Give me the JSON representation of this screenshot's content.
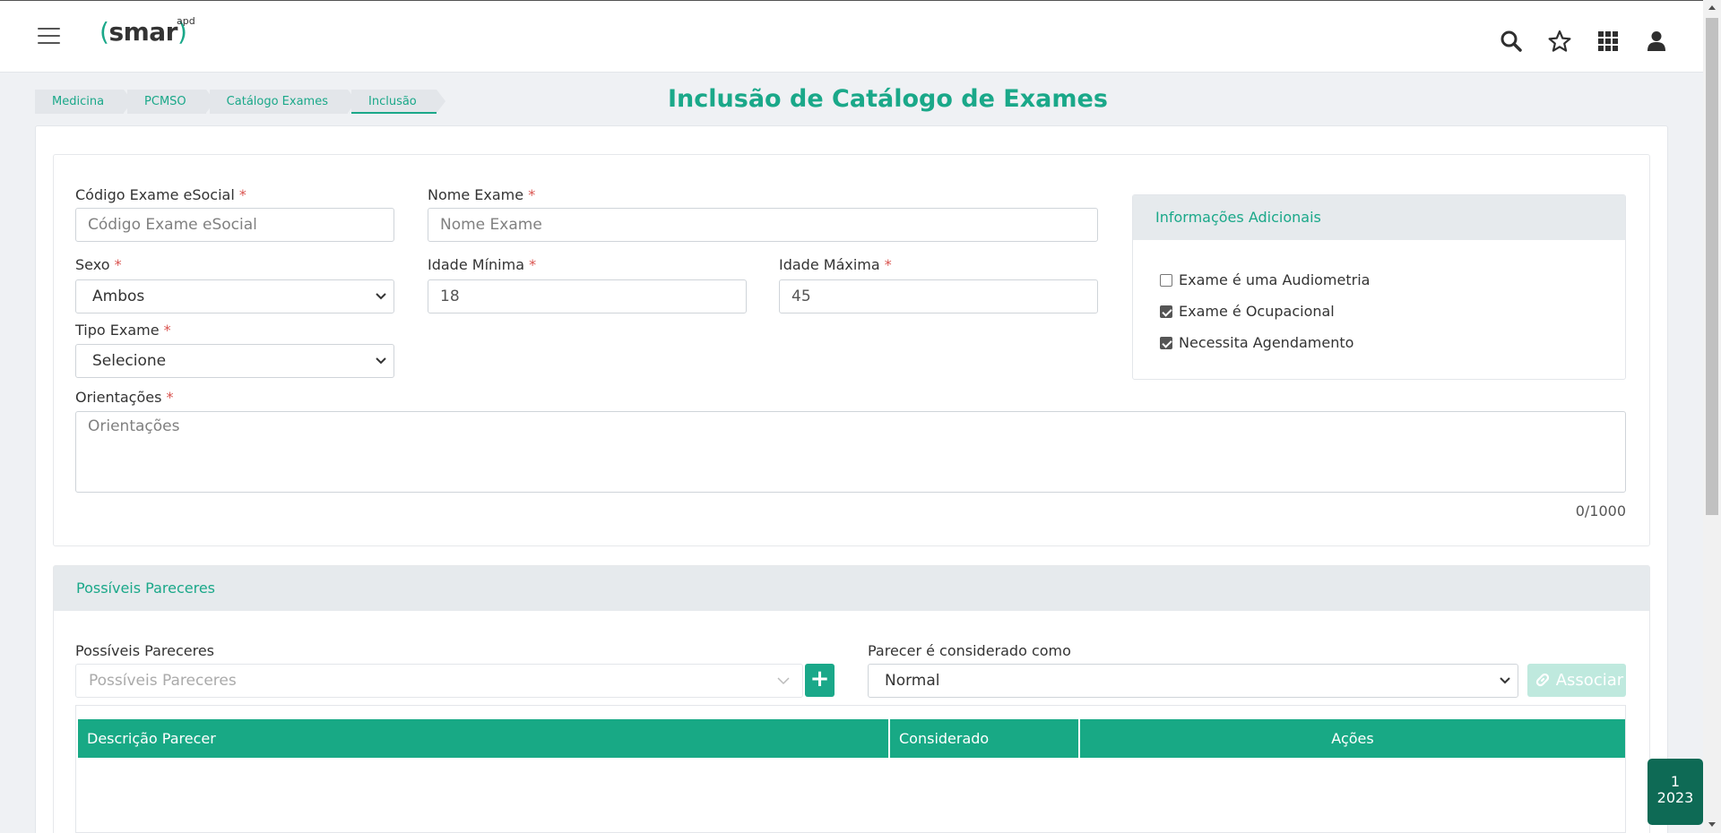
{
  "header": {
    "logo_text": "smar",
    "logo_suffix": "apd",
    "icons": [
      "search-icon",
      "star-icon",
      "apps-grid-icon",
      "user-icon",
      "menu-icon"
    ]
  },
  "breadcrumb": [
    "Medicina",
    "PCMSO",
    "Catálogo Exames",
    "Inclusão"
  ],
  "page_title": "Inclusão de Catálogo de Exames",
  "form": {
    "codigo_label": "Código Exame eSocial",
    "codigo_placeholder": "Código Exame eSocial",
    "nome_label": "Nome Exame",
    "nome_placeholder": "Nome Exame",
    "sexo_label": "Sexo",
    "sexo_value": "Ambos",
    "idade_min_label": "Idade Mínima",
    "idade_min_value": "18",
    "idade_max_label": "Idade Máxima",
    "idade_max_value": "45",
    "tipo_label": "Tipo Exame",
    "tipo_value": "Selecione",
    "orientacoes_label": "Orientações",
    "orientacoes_placeholder": "Orientações",
    "counter": "0/1000",
    "required_mark": "*"
  },
  "info_panel": {
    "title": "Informações Adicionais",
    "checkboxes": [
      {
        "label": "Exame é uma Audiometria",
        "checked": false
      },
      {
        "label": "Exame é Ocupacional",
        "checked": true
      },
      {
        "label": "Necessita Agendamento",
        "checked": true
      }
    ]
  },
  "pareceres": {
    "section_title": "Possíveis Pareceres",
    "field_label": "Possíveis Pareceres",
    "field_placeholder": "Possíveis Pareceres",
    "considerado_label": "Parecer é considerado como",
    "considerado_value": "Normal",
    "add_button": "+",
    "associar_button": "Associar",
    "table_headers": [
      "Descrição Parecer",
      "Considerado",
      "Ações"
    ]
  },
  "badge": {
    "line1": "1",
    "line2": "2023"
  },
  "colors": {
    "accent": "#1aa889",
    "accent_dark": "#0e6a55",
    "table_header": "#18a985"
  }
}
